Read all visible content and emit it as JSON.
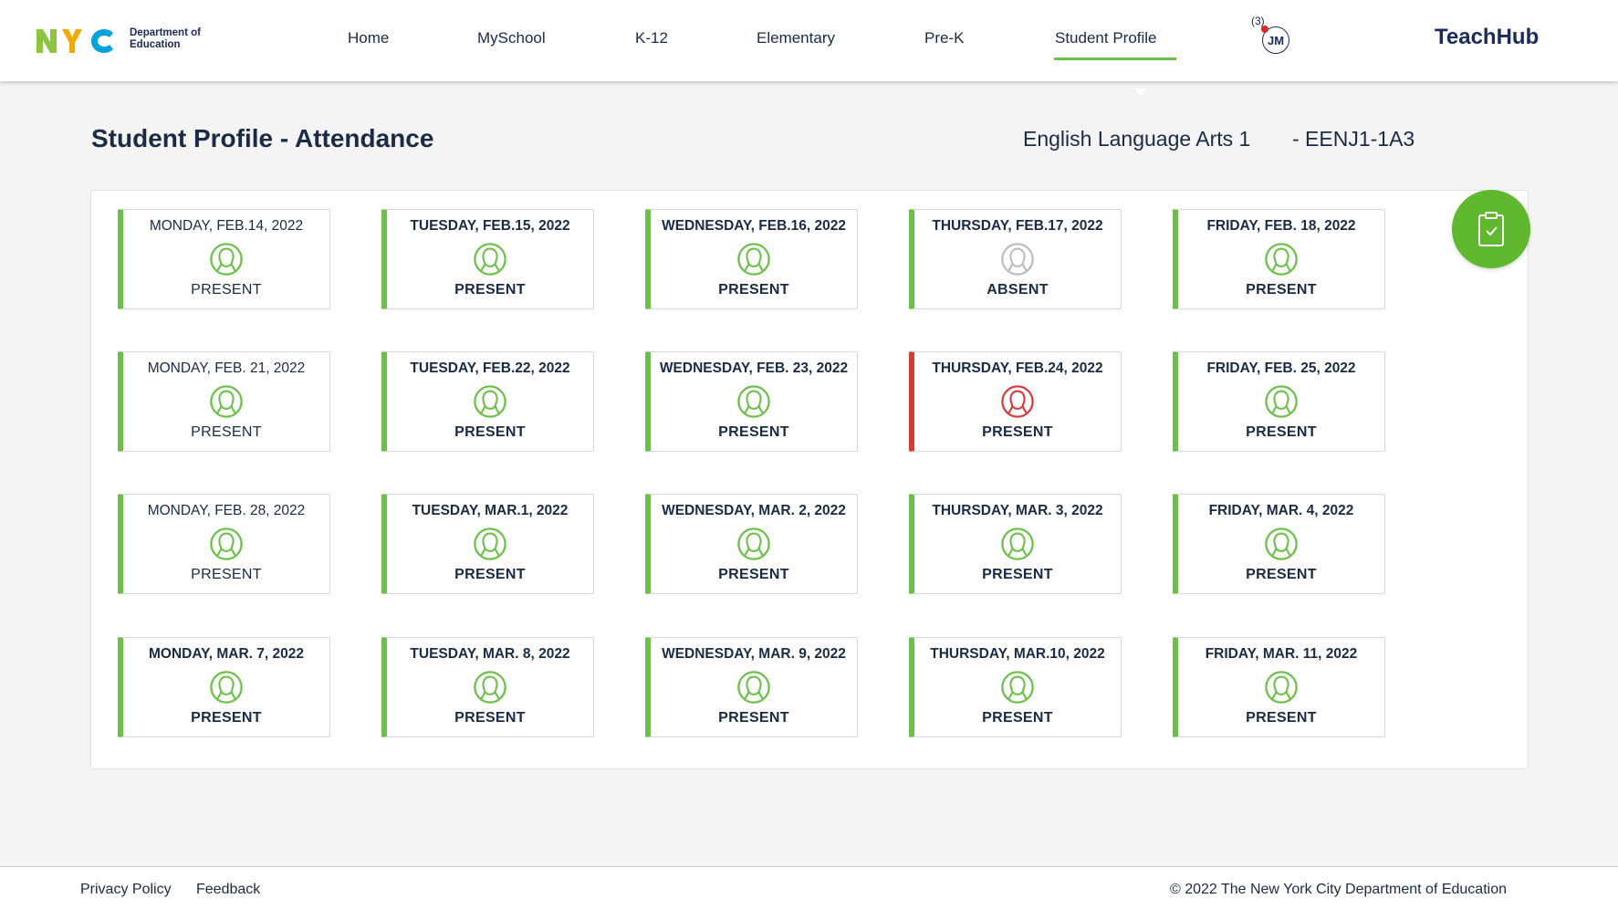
{
  "header": {
    "logo_line1": "Department of",
    "logo_line2": "Education",
    "nav": [
      "Home",
      "MySchool",
      "K-12",
      "Elementary",
      "Pre-K",
      "Student Profile"
    ],
    "active_nav": "Student Profile",
    "notification_count": "(3)",
    "avatar_initials": "JM",
    "brand": "TeachHub"
  },
  "page": {
    "title": "Student Profile - Attendance",
    "course_name": "English Language Arts 1",
    "course_code": "- EENJ1-1A3"
  },
  "colors": {
    "present": "#6cc04a",
    "absent": "#bdbdbd",
    "alert": "#d63b3b",
    "accent": "#5fb82e",
    "text": "#1a2b45"
  },
  "attendance": [
    {
      "date": "MONDAY, FEB.14, 2022",
      "status": "PRESENT",
      "icon": "student-icon",
      "state": "present",
      "bold": false
    },
    {
      "date": "TUESDAY, FEB.15, 2022",
      "status": "PRESENT",
      "icon": "student-icon",
      "state": "present",
      "bold": true
    },
    {
      "date": "WEDNESDAY, FEB.16, 2022",
      "status": "PRESENT",
      "icon": "student-icon",
      "state": "present",
      "bold": true
    },
    {
      "date": "THURSDAY, FEB.17, 2022",
      "status": "ABSENT",
      "icon": "student-icon",
      "state": "absent",
      "bold": true
    },
    {
      "date": "FRIDAY, FEB. 18, 2022",
      "status": "PRESENT",
      "icon": "student-icon",
      "state": "present",
      "bold": true
    },
    {
      "date": "MONDAY, FEB. 21, 2022",
      "status": "PRESENT",
      "icon": "student-icon",
      "state": "present",
      "bold": false
    },
    {
      "date": "TUESDAY, FEB.22, 2022",
      "status": "PRESENT",
      "icon": "student-icon",
      "state": "present",
      "bold": true
    },
    {
      "date": "WEDNESDAY, FEB. 23, 2022",
      "status": "PRESENT",
      "icon": "student-icon",
      "state": "present",
      "bold": true
    },
    {
      "date": "THURSDAY, FEB.24, 2022",
      "status": "PRESENT",
      "icon": "student-icon",
      "state": "alert",
      "bold": true
    },
    {
      "date": "FRIDAY, FEB. 25, 2022",
      "status": "PRESENT",
      "icon": "student-icon",
      "state": "present",
      "bold": true
    },
    {
      "date": "MONDAY, FEB. 28, 2022",
      "status": "PRESENT",
      "icon": "student-icon",
      "state": "present",
      "bold": false
    },
    {
      "date": "TUESDAY, MAR.1, 2022",
      "status": "PRESENT",
      "icon": "student-icon",
      "state": "present",
      "bold": true
    },
    {
      "date": "WEDNESDAY, MAR. 2, 2022",
      "status": "PRESENT",
      "icon": "student-icon",
      "state": "present",
      "bold": true
    },
    {
      "date": "THURSDAY, MAR. 3, 2022",
      "status": "PRESENT",
      "icon": "student-icon",
      "state": "present",
      "bold": true
    },
    {
      "date": "FRIDAY, MAR. 4, 2022",
      "status": "PRESENT",
      "icon": "student-icon",
      "state": "present",
      "bold": true
    },
    {
      "date": "MONDAY, MAR. 7, 2022",
      "status": "PRESENT",
      "icon": "student-icon",
      "state": "present",
      "bold": true
    },
    {
      "date": "TUESDAY, MAR. 8, 2022",
      "status": "PRESENT",
      "icon": "student-icon",
      "state": "present",
      "bold": true
    },
    {
      "date": "WEDNESDAY, MAR. 9, 2022",
      "status": "PRESENT",
      "icon": "student-icon",
      "state": "present",
      "bold": true
    },
    {
      "date": "THURSDAY, MAR.10, 2022",
      "status": "PRESENT",
      "icon": "student-icon",
      "state": "present",
      "bold": true
    },
    {
      "date": "FRIDAY, MAR. 11, 2022",
      "status": "PRESENT",
      "icon": "student-icon",
      "state": "present",
      "bold": true
    }
  ],
  "footer": {
    "privacy": "Privacy Policy",
    "feedback": "Feedback",
    "copyright": "© 2022 The New York City Department of Education"
  }
}
